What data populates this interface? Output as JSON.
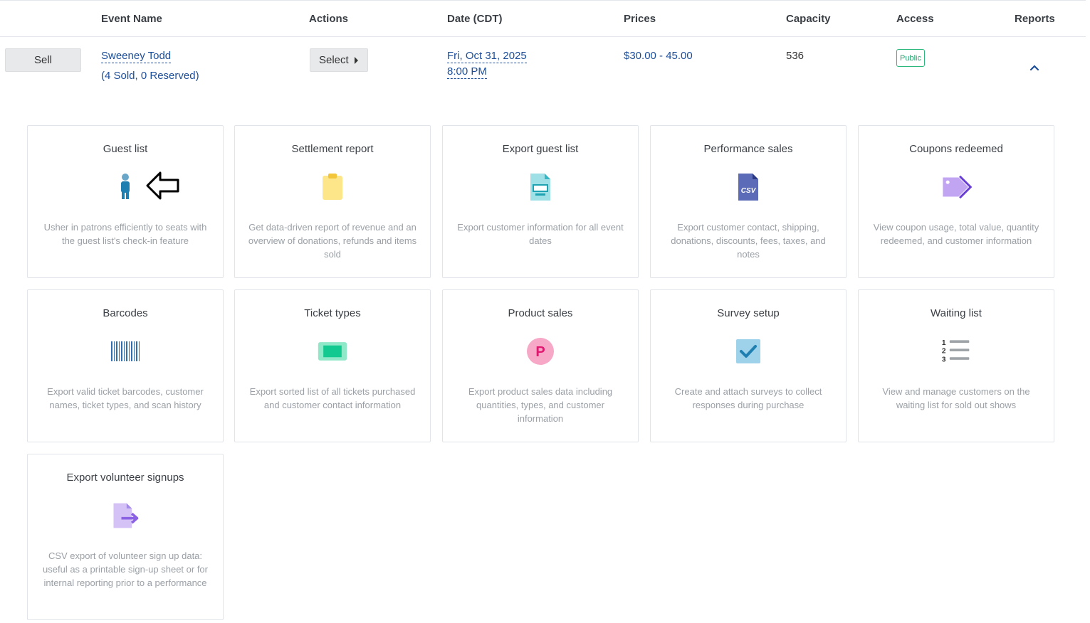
{
  "header": {
    "event_name": "Event Name",
    "actions": "Actions",
    "date": "Date (CDT)",
    "prices": "Prices",
    "capacity": "Capacity",
    "access": "Access",
    "reports": "Reports"
  },
  "row": {
    "sell_label": "Sell",
    "event_name": "Sweeney Todd",
    "sold_info": "(4 Sold, 0 Reserved)",
    "select_label": "Select",
    "date_line1": "Fri, Oct 31, 2025",
    "date_line2": "8:00 PM",
    "prices": "$30.00 - 45.00",
    "capacity": "536",
    "access_badge": "Public"
  },
  "colors": {
    "link": "#1d4e9a",
    "badge_green": "#22a06b",
    "muted_text": "#9aa0a6"
  },
  "reports": [
    {
      "title": "Guest list",
      "icon": "person-icon",
      "desc": "Usher in patrons efficiently to seats with the guest list's check-in feature"
    },
    {
      "title": "Settlement report",
      "icon": "clipboard-icon",
      "desc": "Get data-driven report of revenue and an overview of donations, refunds and items sold"
    },
    {
      "title": "Export guest list",
      "icon": "document-export-icon",
      "desc": "Export customer information for all event dates"
    },
    {
      "title": "Performance sales",
      "icon": "csv-file-icon",
      "desc": "Export customer contact, shipping, donations, discounts, fees, taxes, and notes"
    },
    {
      "title": "Coupons redeemed",
      "icon": "tag-icon",
      "desc": "View coupon usage, total value, quantity redeemed, and customer information"
    },
    {
      "title": "Barcodes",
      "icon": "barcode-icon",
      "desc": "Export valid ticket barcodes, customer names, ticket types, and scan history"
    },
    {
      "title": "Ticket types",
      "icon": "ticket-icon",
      "desc": "Export sorted list of all tickets purchased and customer contact information"
    },
    {
      "title": "Product sales",
      "icon": "product-p-icon",
      "desc": "Export product sales data including quantities, types, and customer information"
    },
    {
      "title": "Survey setup",
      "icon": "checkbox-icon",
      "desc": "Create and attach surveys to collect responses during purchase"
    },
    {
      "title": "Waiting list",
      "icon": "numbered-list-icon",
      "desc": "View and manage customers on the waiting list for sold out shows"
    },
    {
      "title": "Export volunteer signups",
      "icon": "file-export-arrow-icon",
      "desc": "CSV export of volunteer sign up data: useful as a printable sign-up sheet or for internal reporting prior to a performance"
    }
  ]
}
